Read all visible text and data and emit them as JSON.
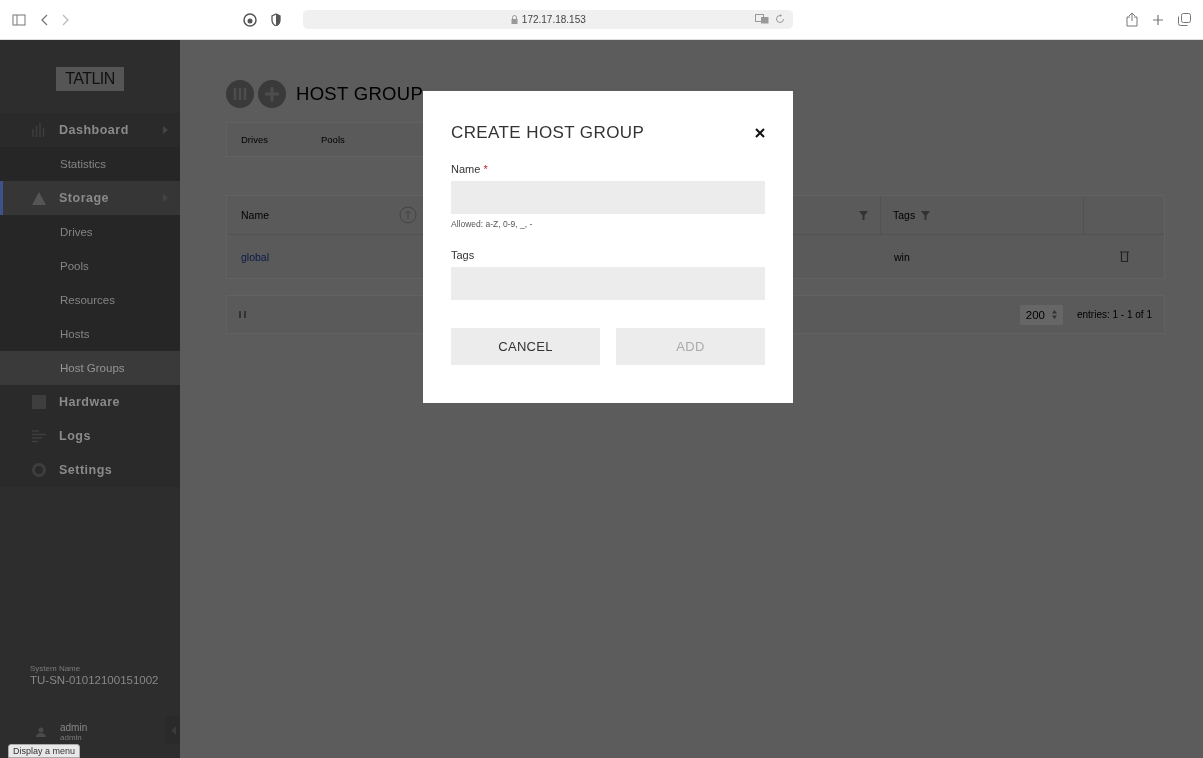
{
  "browser": {
    "address": "172.17.18.153"
  },
  "sidebar": {
    "logo": "TATLIN",
    "items": [
      {
        "label": "Dashboard",
        "selected": false,
        "children": [
          {
            "label": "Statistics",
            "selected": false
          }
        ]
      },
      {
        "label": "Storage",
        "selected": true,
        "children": [
          {
            "label": "Drives",
            "selected": false
          },
          {
            "label": "Pools",
            "selected": false
          },
          {
            "label": "Resources",
            "selected": false
          },
          {
            "label": "Hosts",
            "selected": false
          },
          {
            "label": "Host Groups",
            "selected": true
          }
        ]
      },
      {
        "label": "Hardware",
        "selected": false
      },
      {
        "label": "Logs",
        "selected": false
      },
      {
        "label": "Settings",
        "selected": false
      }
    ],
    "system_name_label": "System Name",
    "system_name": "TU-SN-01012100151002",
    "user": {
      "name": "admin",
      "role": "admin"
    },
    "tooltip": "Display a menu"
  },
  "page": {
    "title": "HOST GROUP",
    "tabs": [
      {
        "label": "Drives",
        "selected": false
      },
      {
        "label": "Pools",
        "selected": false
      }
    ],
    "table": {
      "columns": [
        {
          "label": "Name",
          "kind": "sort"
        },
        {
          "label": "Tags",
          "kind": "filter"
        }
      ],
      "rows": [
        {
          "name": "global",
          "tags": "win"
        }
      ]
    },
    "page_size": "200",
    "entries": "entries: 1 - 1 of 1"
  },
  "modal": {
    "title": "CREATE HOST GROUP",
    "required_mark": "*",
    "fields": [
      {
        "label": "Name",
        "required": true,
        "hint": "Allowed: a-Z, 0-9, _, -"
      },
      {
        "label": "Tags",
        "required": false
      }
    ],
    "buttons": [
      {
        "label": "CANCEL",
        "disabled": false
      },
      {
        "label": "ADD",
        "disabled": true
      }
    ]
  }
}
